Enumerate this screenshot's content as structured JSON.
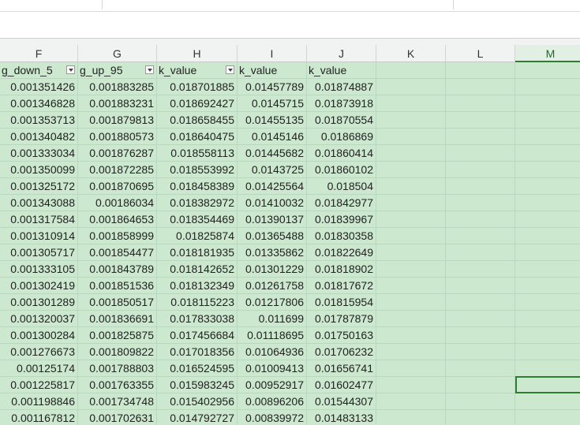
{
  "columns": [
    "F",
    "G",
    "H",
    "I",
    "J",
    "K",
    "L",
    "M"
  ],
  "selected_column": "M",
  "table": {
    "headers": [
      "g_down_5",
      "g_up_95",
      "k_value",
      "k_value",
      "k_value"
    ],
    "filter_columns": [
      0,
      1,
      2
    ],
    "rows": [
      [
        "0.001351426",
        "0.001883285",
        "0.018701885",
        "0.01457789",
        "0.01874887"
      ],
      [
        "0.001346828",
        "0.001883231",
        "0.018692427",
        "0.0145715",
        "0.01873918"
      ],
      [
        "0.001353713",
        "0.001879813",
        "0.018658455",
        "0.01455135",
        "0.01870554"
      ],
      [
        "0.001340482",
        "0.001880573",
        "0.018640475",
        "0.0145146",
        "0.0186869"
      ],
      [
        "0.001333034",
        "0.001876287",
        "0.018558113",
        "0.01445682",
        "0.01860414"
      ],
      [
        "0.001350099",
        "0.001872285",
        "0.018553992",
        "0.0143725",
        "0.01860102"
      ],
      [
        "0.001325172",
        "0.001870695",
        "0.018458389",
        "0.01425564",
        "0.018504"
      ],
      [
        "0.001343088",
        "0.00186034",
        "0.018382972",
        "0.01410032",
        "0.01842977"
      ],
      [
        "0.001317584",
        "0.001864653",
        "0.018354469",
        "0.01390137",
        "0.01839967"
      ],
      [
        "0.001310914",
        "0.001858999",
        "0.01825874",
        "0.01365488",
        "0.01830358"
      ],
      [
        "0.001305717",
        "0.001854477",
        "0.018181935",
        "0.01335862",
        "0.01822649"
      ],
      [
        "0.001333105",
        "0.001843789",
        "0.018142652",
        "0.01301229",
        "0.01818902"
      ],
      [
        "0.001302419",
        "0.001851536",
        "0.018132349",
        "0.01261758",
        "0.01817672"
      ],
      [
        "0.001301289",
        "0.001850517",
        "0.018115223",
        "0.01217806",
        "0.01815954"
      ],
      [
        "0.001320037",
        "0.001836691",
        "0.017833038",
        "0.011699",
        "0.01787879"
      ],
      [
        "0.001300284",
        "0.001825875",
        "0.017456684",
        "0.01118695",
        "0.01750163"
      ],
      [
        "0.001276673",
        "0.001809822",
        "0.017018356",
        "0.01064936",
        "0.01706232"
      ],
      [
        "0.00125174",
        "0.001788803",
        "0.016524595",
        "0.01009413",
        "0.01656741"
      ],
      [
        "0.001225817",
        "0.001763355",
        "0.015983245",
        "0.00952917",
        "0.01602477"
      ],
      [
        "0.001198846",
        "0.001734748",
        "0.015402956",
        "0.00896206",
        "0.01544307"
      ],
      [
        "0.001167812",
        "0.001702631",
        "0.014792727",
        "0.00839972",
        "0.01483133"
      ]
    ]
  },
  "active_cell": {
    "column": "M",
    "row_index": 18
  },
  "colors": {
    "cell_fill": "#cce8cf",
    "grid_line": "#b9d8bf",
    "selection": "#2e7d32"
  }
}
